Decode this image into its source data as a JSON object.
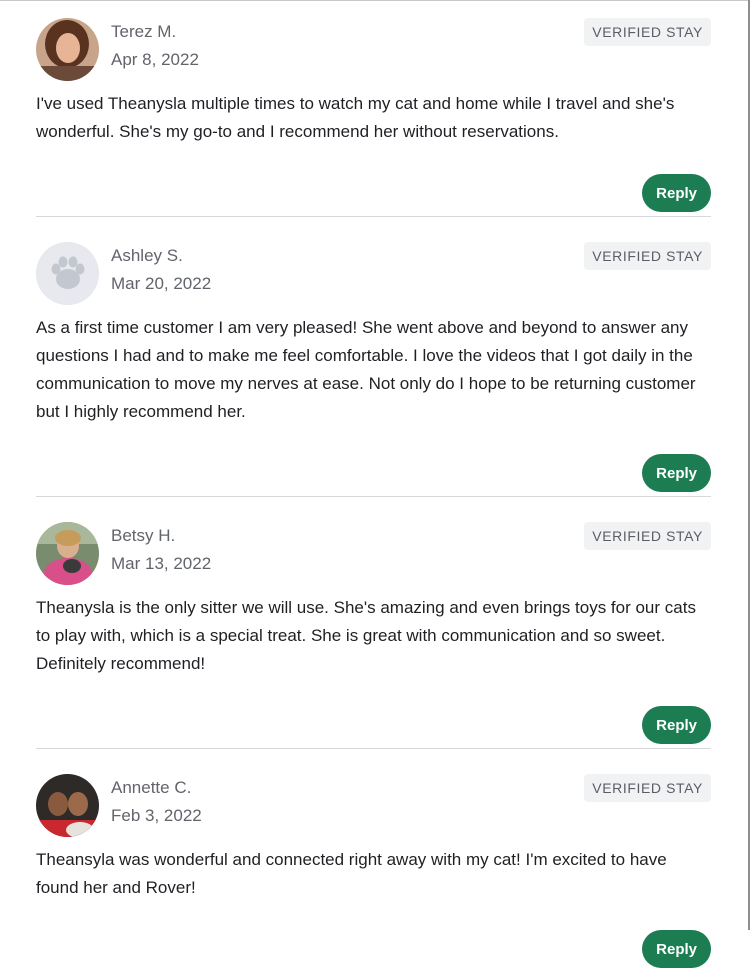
{
  "reviews": [
    {
      "name": "Terez M.",
      "date": "Apr 8, 2022",
      "badge": "VERIFIED STAY",
      "text": "I've used Theanysla multiple times to watch my cat and home while I travel and she's wonderful. She's my go-to and I recommend her without reservations.",
      "reply_label": "Reply",
      "avatar": "photo"
    },
    {
      "name": "Ashley S.",
      "date": "Mar 20, 2022",
      "badge": "VERIFIED STAY",
      "text": "As a first time customer I am very pleased! She went above and beyond to answer any questions I had and to make me feel comfortable. I love the videos that I got daily in the communication to move my nerves at ease. Not only do I hope to be returning customer but I highly recommend her.",
      "reply_label": "Reply",
      "avatar": "paw-icon"
    },
    {
      "name": "Betsy H.",
      "date": "Mar 13, 2022",
      "badge": "VERIFIED STAY",
      "text": "Theanysla is the only sitter we will use. She's amazing and even brings toys for our cats to play with, which is a special treat. She is great with communication and so sweet. Definitely recommend!",
      "reply_label": "Reply",
      "avatar": "photo"
    },
    {
      "name": "Annette C.",
      "date": "Feb 3, 2022",
      "badge": "VERIFIED STAY",
      "text": "Theansyla was wonderful and connected right away with my cat! I'm excited to have found her and Rover!",
      "reply_label": "Reply",
      "avatar": "photo"
    }
  ],
  "colors": {
    "accent": "#1c7d52",
    "badge_bg": "#f1f2f4",
    "divider": "#d7d8dc"
  }
}
